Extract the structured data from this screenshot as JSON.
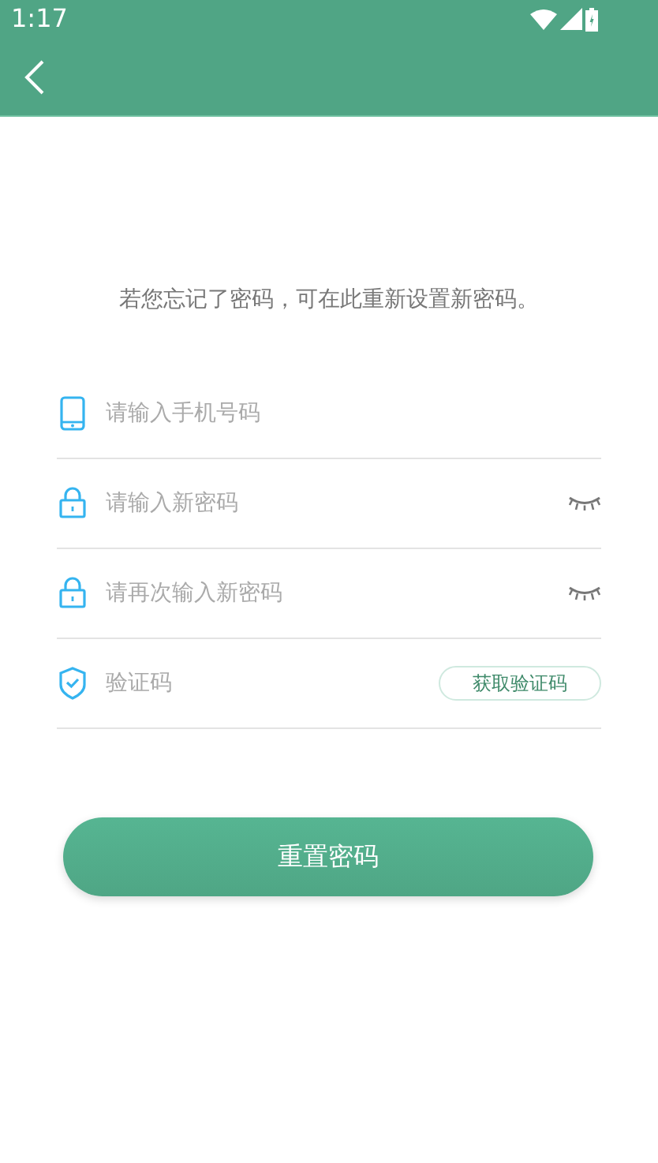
{
  "status_bar": {
    "time": "1:17"
  },
  "intro": "若您忘记了密码，可在此重新设置新密码。",
  "fields": [
    {
      "kind": "phone",
      "placeholder": "请输入手机号码"
    },
    {
      "kind": "password",
      "placeholder": "请输入新密码"
    },
    {
      "kind": "password",
      "placeholder": "请再次输入新密码"
    },
    {
      "kind": "code",
      "placeholder": "验证码",
      "button": "获取验证码"
    }
  ],
  "submit": "重置密码"
}
